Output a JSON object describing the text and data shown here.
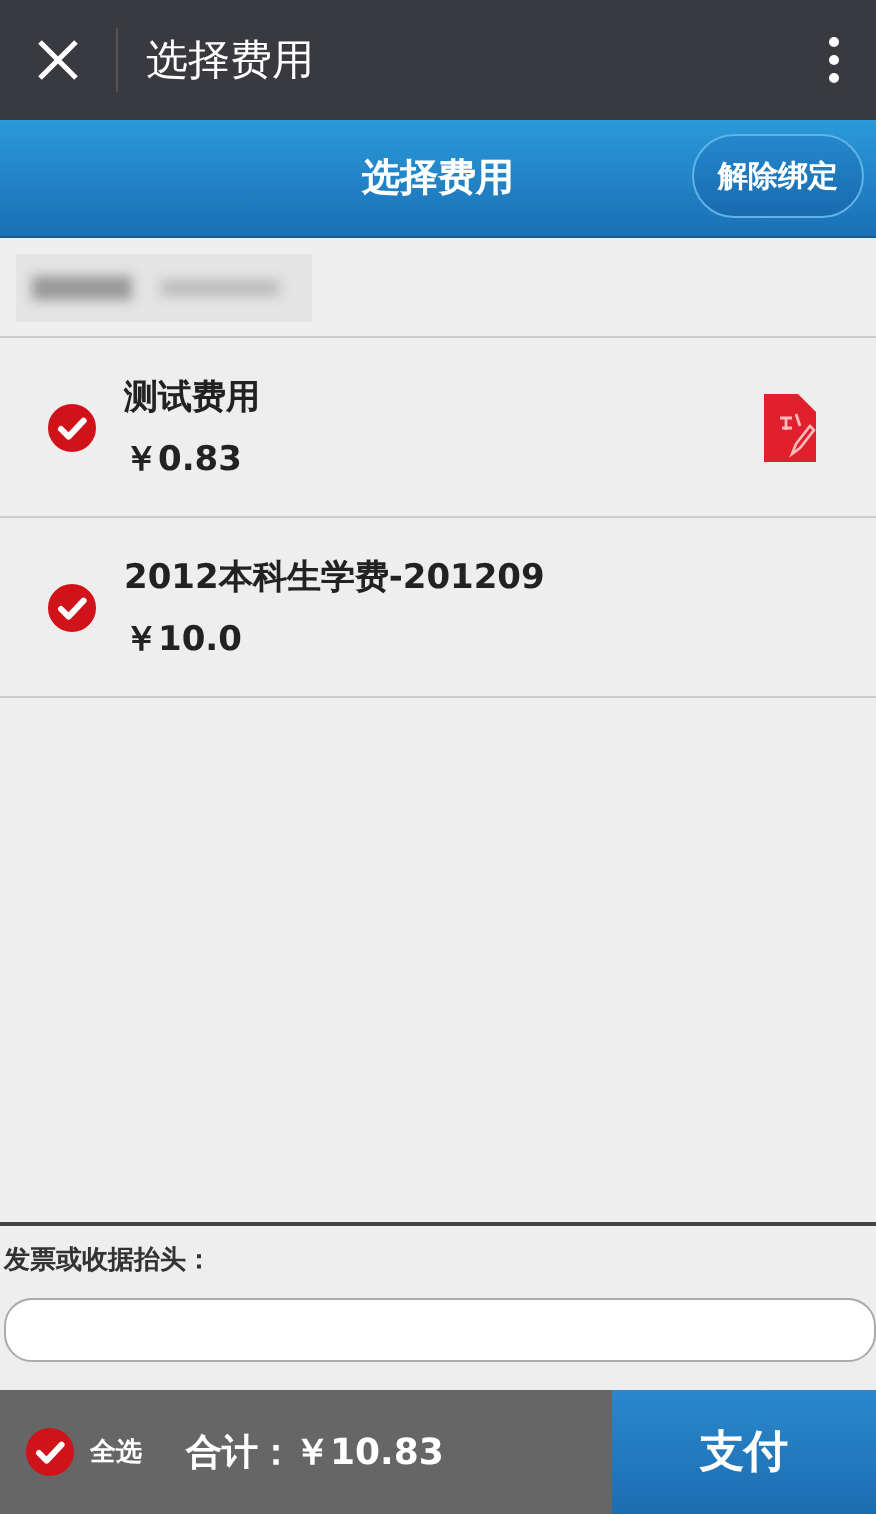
{
  "window": {
    "title": "选择费用"
  },
  "header": {
    "title": "选择费用",
    "unbind_button": "解除绑定"
  },
  "fees": [
    {
      "name": "测试费用",
      "amount": "￥0.83",
      "checked": true,
      "editable": true
    },
    {
      "name": "2012本科生学费-201209",
      "amount": "￥10.0",
      "checked": true,
      "editable": false
    }
  ],
  "invoice": {
    "label": "发票或收据抬头："
  },
  "footer": {
    "select_all": {
      "label": "全选",
      "checked": true
    },
    "total": "合计：￥10.83",
    "pay_button": "支付"
  }
}
